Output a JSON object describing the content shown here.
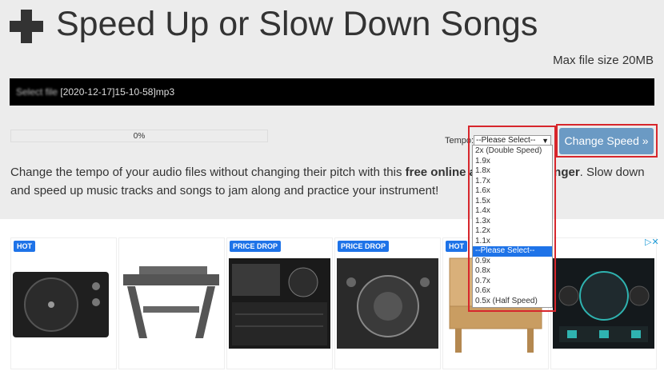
{
  "header": {
    "title": "Speed Up or Slow Down Songs",
    "max_file_size": "Max file size 20MB"
  },
  "file_input": {
    "obscured_prefix": "Select file",
    "filename_suffix": "[2020-12-17]15-10-58]mp3"
  },
  "progress": {
    "label": "0%",
    "value_percent": 0
  },
  "tempo": {
    "label": "Tempo:",
    "selected": "--Please Select--",
    "options": [
      "2x (Double Speed)",
      "1.9x",
      "1.8x",
      "1.7x",
      "1.6x",
      "1.5x",
      "1.4x",
      "1.3x",
      "1.2x",
      "1.1x",
      "--Please Select--",
      "0.9x",
      "0.8x",
      "0.7x",
      "0.6x",
      "0.5x (Half Speed)"
    ],
    "highlighted_index": 10
  },
  "actions": {
    "change_speed": "Change Speed »"
  },
  "description": {
    "part1": "Change the tempo of your audio files without changing their pitch with this ",
    "bold1": "free online au",
    "bold2": "nger",
    "part2": ". Slow down and speed up music tracks and songs to jam along and practice your instrument!"
  },
  "ads": [
    {
      "badge": "HOT"
    },
    {
      "badge": ""
    },
    {
      "badge": "PRICE DROP"
    },
    {
      "badge": "PRICE DROP"
    },
    {
      "badge": "HOT"
    },
    {
      "badge": ""
    }
  ],
  "colors": {
    "accent": "#1e73e8",
    "button": "#6b9ac4",
    "highlight": "#d7262c"
  }
}
